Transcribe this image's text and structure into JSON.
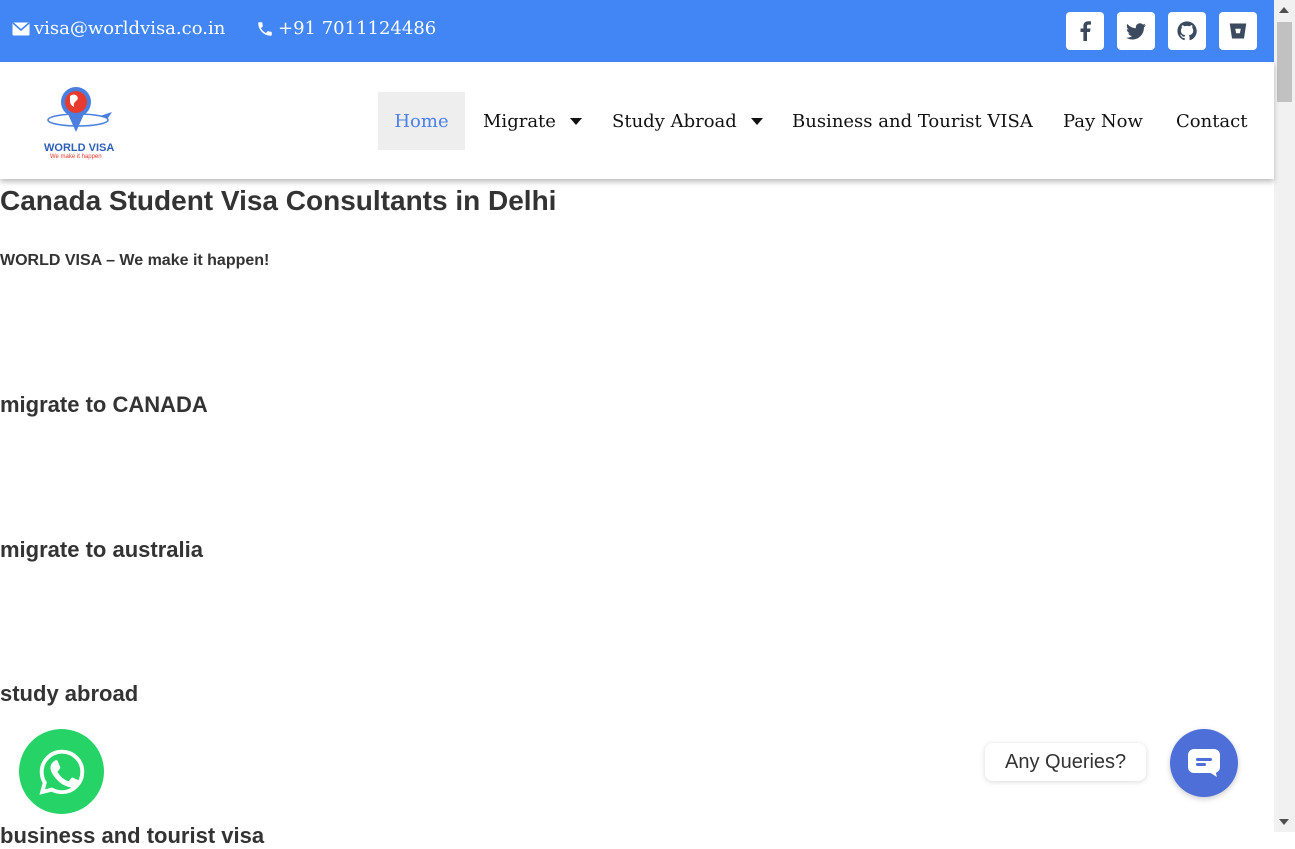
{
  "topbar": {
    "email": "visa@worldvisa.co.in",
    "phone": "+91 7011124486",
    "bg_color": "#4285f4",
    "social_icons": [
      "facebook-icon",
      "twitter-icon",
      "github-icon",
      "bitbucket-icon"
    ]
  },
  "header": {
    "logo_text": "WORLD VISA",
    "logo_tagline": "We make it happen",
    "nav": [
      {
        "label": "Home",
        "active": true
      },
      {
        "label": "Migrate",
        "dropdown": true
      },
      {
        "label": "Study Abroad",
        "dropdown": true
      },
      {
        "label": "Business and Tourist VISA"
      },
      {
        "label": "Pay Now"
      },
      {
        "label": "Contact"
      }
    ]
  },
  "content": {
    "title": "Canada Student Visa Consultants in Delhi",
    "tagline": "WORLD VISA – We make it happen!",
    "sections": [
      "migrate to CANADA",
      "migrate to australia",
      "study abroad",
      "business and tourist visa"
    ]
  },
  "widgets": {
    "whatsapp_icon": "whatsapp-icon",
    "queries_label": "Any Queries?",
    "chat_icon": "chat-icon"
  }
}
